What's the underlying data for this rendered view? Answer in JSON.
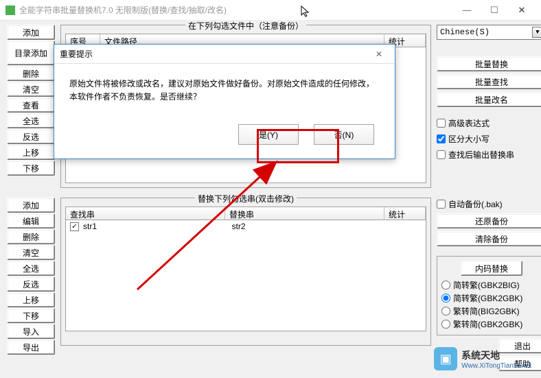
{
  "title": "全能字符串批量替换机7.0 无限制版(替换/查找/抽取/改名)",
  "window_controls": {
    "min": "—",
    "max": "☐",
    "close": "✕"
  },
  "top_group": {
    "title": "在下列勾选文件中（注意备份）",
    "buttons": [
      "添加",
      "目录添加",
      "删除",
      "清空",
      "查看",
      "全选",
      "反选",
      "上移",
      "下移"
    ],
    "headers": {
      "seq": "序号",
      "path": "文件路径",
      "stats": "统计"
    }
  },
  "lower_group": {
    "title": "替换下列勾选串(双击修改)",
    "buttons": [
      "添加",
      "编辑",
      "删除",
      "清空",
      "全选",
      "反选",
      "上移",
      "下移",
      "导入",
      "导出"
    ],
    "headers": {
      "find": "查找串",
      "replace": "替换串",
      "stats": "统计"
    },
    "rows": [
      {
        "checked": true,
        "find": "str1",
        "replace": "str2"
      }
    ]
  },
  "right": {
    "language": "Chinese(S)",
    "batch_buttons": [
      "批量替换",
      "批量查找",
      "批量改名"
    ],
    "options": {
      "advanced_expr": {
        "label": "高级表达式",
        "checked": false
      },
      "case_sensitive": {
        "label": "区分大小写",
        "checked": true
      },
      "output_after_find": {
        "label": "查找后输出替换串",
        "checked": false
      },
      "auto_backup": {
        "label": "自动备份(.bak)",
        "checked": false
      }
    },
    "backup_buttons": [
      "还原备份",
      "清除备份"
    ],
    "encoding_group": {
      "title": "内码替换",
      "radios": [
        {
          "label": "简转繁(GBK2BIG)",
          "checked": false
        },
        {
          "label": "简转繁(GBK2GBK)",
          "checked": true
        },
        {
          "label": "繁转简(BIG2GBK)",
          "checked": false
        },
        {
          "label": "繁转简(GBK2GBK)",
          "checked": false
        }
      ]
    },
    "exit": "退出",
    "help": "帮助"
  },
  "dialog": {
    "title": "重要提示",
    "body": "原始文件将被修改或改名，建议对原始文件做好备份。对原始文件造成的任何修改，本软件作者不负责恢复。是否继续？",
    "yes": "是(Y)",
    "no": "否(N)"
  },
  "watermark": {
    "name": "系统天地",
    "url": "Www.XiTongTianDi.net"
  }
}
